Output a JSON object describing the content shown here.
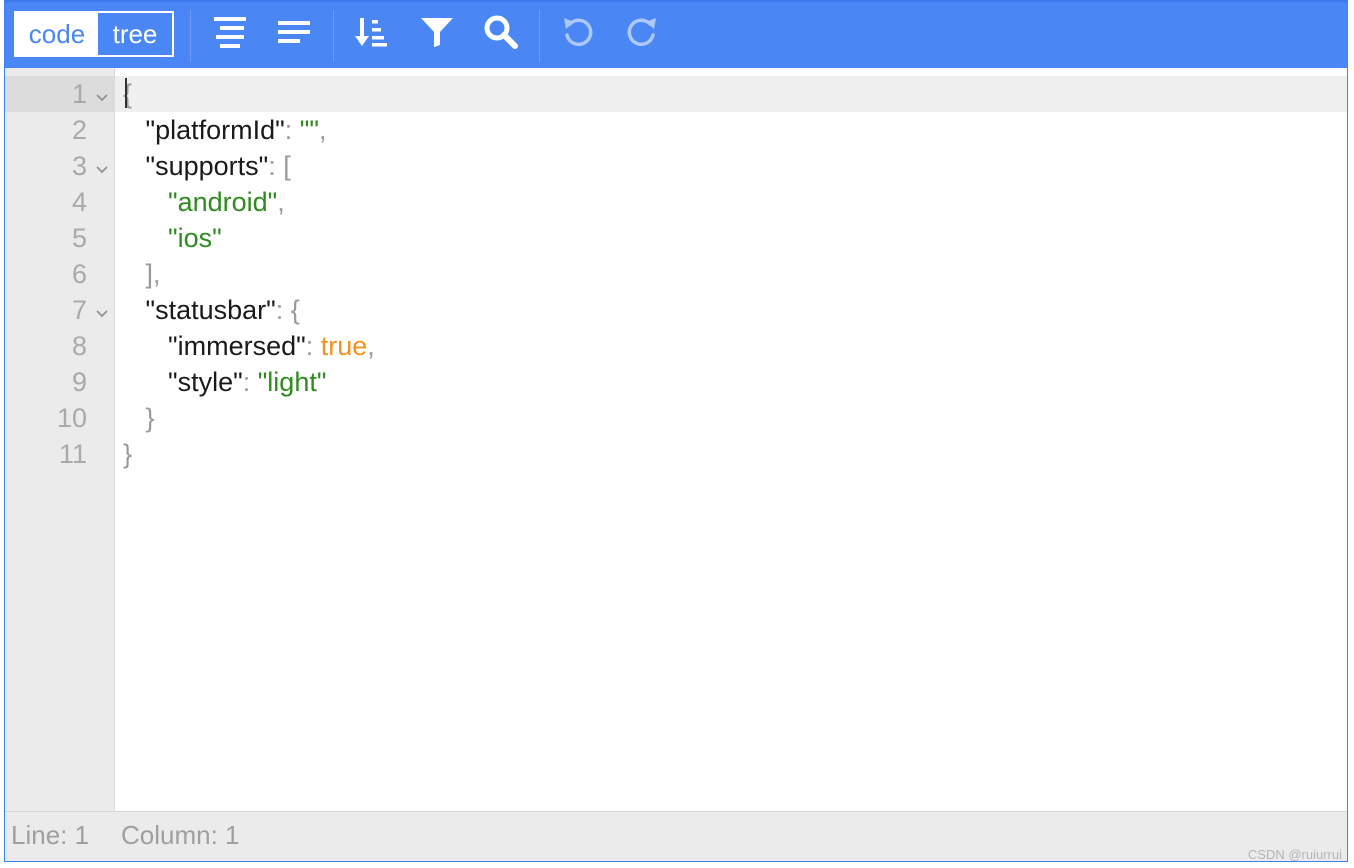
{
  "toolbar": {
    "mode_code": "code",
    "mode_tree": "tree",
    "icons": [
      "format-icon",
      "compact-icon",
      "sort-icon",
      "filter-icon",
      "search-icon",
      "undo-icon",
      "redo-icon"
    ],
    "colors": {
      "background": "#4a87f4",
      "accent": "#ffffff"
    }
  },
  "editor": {
    "line_numbers": [
      "1",
      "2",
      "3",
      "4",
      "5",
      "6",
      "7",
      "8",
      "9",
      "10",
      "11"
    ],
    "lines": [
      {
        "indent": "",
        "tokens": [
          {
            "t": "punct",
            "v": "{"
          }
        ]
      },
      {
        "indent": "   ",
        "tokens": [
          {
            "t": "key",
            "v": "\"platformId\""
          },
          {
            "t": "punct",
            "v": ": "
          },
          {
            "t": "str",
            "v": "\"\""
          },
          {
            "t": "punct",
            "v": ","
          }
        ]
      },
      {
        "indent": "   ",
        "tokens": [
          {
            "t": "key",
            "v": "\"supports\""
          },
          {
            "t": "punct",
            "v": ": ["
          }
        ]
      },
      {
        "indent": "      ",
        "tokens": [
          {
            "t": "str",
            "v": "\"android\""
          },
          {
            "t": "punct",
            "v": ","
          }
        ]
      },
      {
        "indent": "      ",
        "tokens": [
          {
            "t": "str",
            "v": "\"ios\""
          }
        ]
      },
      {
        "indent": "   ",
        "tokens": [
          {
            "t": "punct",
            "v": "],"
          }
        ]
      },
      {
        "indent": "   ",
        "tokens": [
          {
            "t": "key",
            "v": "\"statusbar\""
          },
          {
            "t": "punct",
            "v": ": {"
          }
        ]
      },
      {
        "indent": "      ",
        "tokens": [
          {
            "t": "key",
            "v": "\"immersed\""
          },
          {
            "t": "punct",
            "v": ": "
          },
          {
            "t": "bool",
            "v": "true"
          },
          {
            "t": "punct",
            "v": ","
          }
        ]
      },
      {
        "indent": "      ",
        "tokens": [
          {
            "t": "key",
            "v": "\"style\""
          },
          {
            "t": "punct",
            "v": ": "
          },
          {
            "t": "str",
            "v": "\"light\""
          }
        ]
      },
      {
        "indent": "   ",
        "tokens": [
          {
            "t": "punct",
            "v": "}"
          }
        ]
      },
      {
        "indent": "",
        "tokens": [
          {
            "t": "punct",
            "v": "}"
          }
        ]
      }
    ],
    "foldable_lines": [
      1,
      3,
      7
    ],
    "colors": {
      "key": "#1a1a1a",
      "string": "#2e8b1e",
      "boolean": "#f39120",
      "punctuation": "#9a9a9a"
    }
  },
  "statusbar": {
    "line_label": "Line: 1",
    "column_label": "Column: 1"
  },
  "watermark": "CSDN @ruiurrui"
}
